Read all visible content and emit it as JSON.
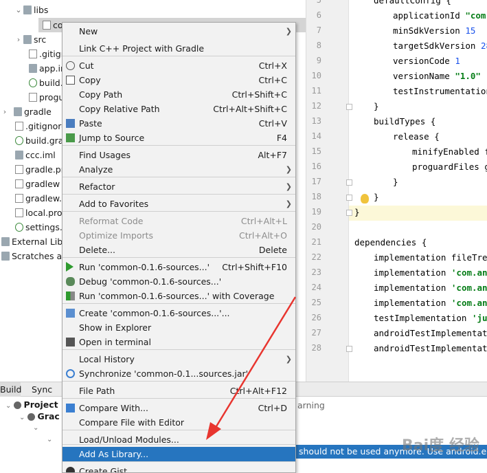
{
  "tree": {
    "items": [
      {
        "label": "libs"
      },
      {
        "label": "co"
      },
      {
        "label": "src"
      },
      {
        "label": ".gitigr"
      },
      {
        "label": "app.ir"
      },
      {
        "label": "build."
      },
      {
        "label": "progu"
      },
      {
        "label": "gradle"
      },
      {
        "label": ".gitignore"
      },
      {
        "label": "build.gra"
      },
      {
        "label": "ccc.iml"
      },
      {
        "label": "gradle.pr"
      },
      {
        "label": "gradlew"
      },
      {
        "label": "gradlew.b"
      },
      {
        "label": "local.prop"
      },
      {
        "label": "settings.g"
      },
      {
        "label": "External Libr"
      },
      {
        "label": "Scratches an"
      }
    ]
  },
  "editor": {
    "line_numbers": [
      "5",
      "6",
      "7",
      "8",
      "9",
      "10",
      "11",
      "12",
      "13",
      "14",
      "15",
      "16",
      "17",
      "18",
      "19",
      "20",
      "21",
      "22",
      "23",
      "24",
      "25",
      "26",
      "27",
      "28"
    ],
    "lines": [
      {
        "plain": "defaultConfig {"
      },
      {
        "plain": "applicationId ",
        "str": "\"com."
      },
      {
        "plain": "minSdkVersion ",
        "num": "15"
      },
      {
        "plain": "targetSdkVersion ",
        "num": "28"
      },
      {
        "plain": "versionCode ",
        "num": "1"
      },
      {
        "plain": "versionName ",
        "str": "\"1.0\""
      },
      {
        "plain": "testInstrumentationR"
      },
      {
        "plain": "}"
      },
      {
        "plain": "buildTypes {"
      },
      {
        "plain": "release {"
      },
      {
        "plain": "minifyEnabled fa"
      },
      {
        "plain": "proguardFiles ge"
      },
      {
        "plain": "}"
      },
      {
        "plain": "}"
      },
      {
        "plain": "}"
      },
      {
        "plain": ""
      },
      {
        "plain": "dependencies {"
      },
      {
        "plain": "implementation fileTree("
      },
      {
        "plain": "implementation ",
        "str": "'com.and"
      },
      {
        "plain": "implementation ",
        "str": "'com.and"
      },
      {
        "plain": "implementation ",
        "str": "'com.and"
      },
      {
        "plain": "testImplementation ",
        "str": "'jun"
      },
      {
        "plain": "androidTestImplementation"
      },
      {
        "plain": "androidTestImplementation"
      }
    ]
  },
  "bottom": {
    "tabs": [
      "Build",
      "Sync"
    ],
    "rows": [
      "Project",
      "Grac",
      "arning"
    ],
    "message": "should not be used anymore. Use android.enab"
  },
  "menu": {
    "items": [
      {
        "label": "New",
        "shortcut": "",
        "submenu": true
      },
      {
        "label": "Link C++ Project with Gradle",
        "shortcut": ""
      },
      {
        "label": "Cut",
        "shortcut": "Ctrl+X",
        "icon": "cut-icon"
      },
      {
        "label": "Copy",
        "shortcut": "Ctrl+C",
        "icon": "copy-icon"
      },
      {
        "label": "Copy Path",
        "shortcut": "Ctrl+Shift+C"
      },
      {
        "label": "Copy Relative Path",
        "shortcut": "Ctrl+Alt+Shift+C"
      },
      {
        "label": "Paste",
        "shortcut": "Ctrl+V",
        "icon": "paste-icon"
      },
      {
        "label": "Jump to Source",
        "shortcut": "F4",
        "icon": "jump-icon"
      },
      {
        "label": "Find Usages",
        "shortcut": "Alt+F7"
      },
      {
        "label": "Analyze",
        "shortcut": "",
        "submenu": true
      },
      {
        "label": "Refactor",
        "shortcut": "",
        "submenu": true
      },
      {
        "label": "Add to Favorites",
        "shortcut": "",
        "submenu": true
      },
      {
        "label": "Reformat Code",
        "shortcut": "Ctrl+Alt+L",
        "disabled": true
      },
      {
        "label": "Optimize Imports",
        "shortcut": "Ctrl+Alt+O",
        "disabled": true
      },
      {
        "label": "Delete...",
        "shortcut": "Delete"
      },
      {
        "label": "Run 'common-0.1.6-sources...'",
        "shortcut": "Ctrl+Shift+F10",
        "icon": "run-icon"
      },
      {
        "label": "Debug 'common-0.1.6-sources...'",
        "shortcut": "",
        "icon": "debug-icon"
      },
      {
        "label": "Run 'common-0.1.6-sources...' with Coverage",
        "shortcut": "",
        "icon": "coverage-icon"
      },
      {
        "label": "Create 'common-0.1.6-sources...'...",
        "shortcut": "",
        "icon": "create-icon"
      },
      {
        "label": "Show in Explorer",
        "shortcut": ""
      },
      {
        "label": "Open in terminal",
        "shortcut": "",
        "icon": "terminal-icon"
      },
      {
        "label": "Local History",
        "shortcut": "",
        "submenu": true
      },
      {
        "label": "Synchronize 'common-0.1...sources.jar'",
        "shortcut": "",
        "icon": "sync-icon"
      },
      {
        "label": "File Path",
        "shortcut": "Ctrl+Alt+F12"
      },
      {
        "label": "Compare With...",
        "shortcut": "Ctrl+D",
        "icon": "compare-icon"
      },
      {
        "label": "Compare File with Editor",
        "shortcut": ""
      },
      {
        "label": "Load/Unload Modules...",
        "shortcut": ""
      },
      {
        "label": "Add As Library...",
        "shortcut": "",
        "selected": true
      },
      {
        "label": "Create Gist...",
        "shortcut": "",
        "icon": "github-icon"
      }
    ]
  },
  "watermark": "Bai度 经验",
  "colors": {
    "accent": "#2675bf",
    "annotation_arrow": "#e8352f"
  }
}
